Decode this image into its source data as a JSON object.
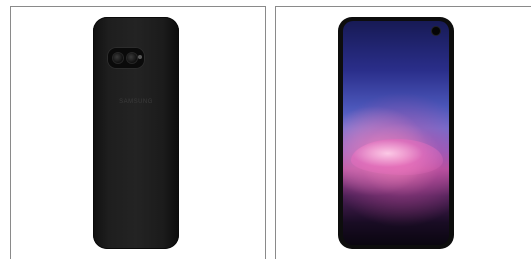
{
  "products": [
    {
      "view": "back",
      "brand_text": "SAMSUNG",
      "case_color": "#1d1d1d"
    },
    {
      "view": "front",
      "case_color": "#0d0d0d"
    }
  ]
}
